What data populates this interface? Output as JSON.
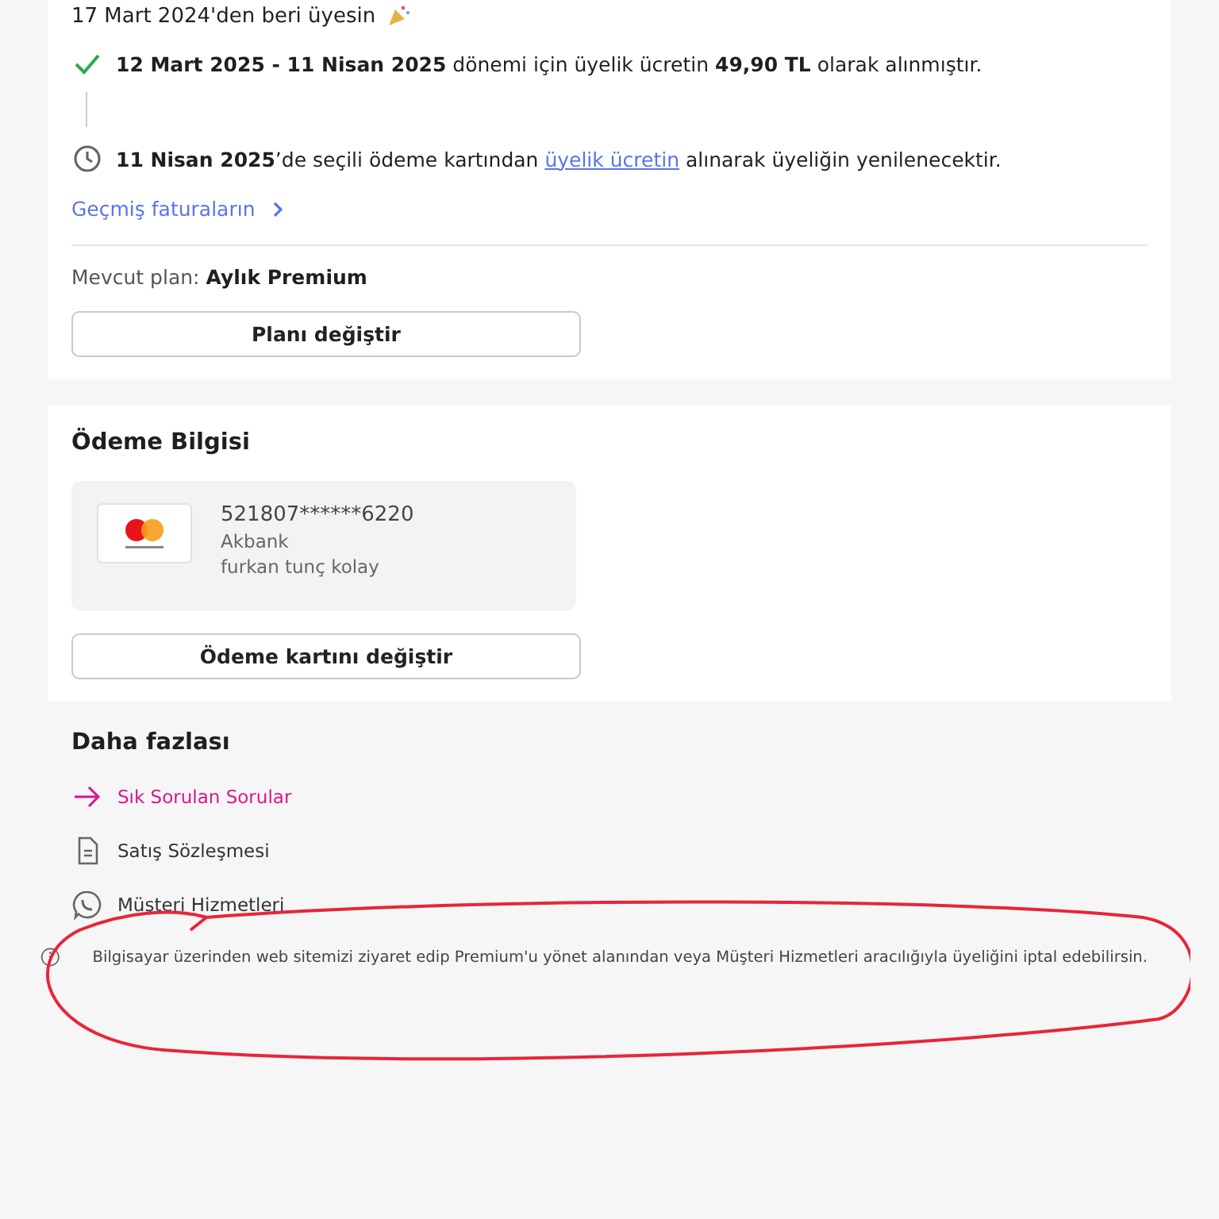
{
  "membership": {
    "since": "17 Mart 2024'den beri üyesin",
    "timeline": [
      {
        "kind": "done",
        "text": "**12 Mart 2025 - 11 Nisan 2025** dönemi için üyelik ücretin **49,90 TL** olarak alınmıştır."
      },
      {
        "kind": "pending",
        "text": "**11 Nisan 2025**’de seçili ödeme kartından ",
        "link": "üyelik ücretin",
        "text_after": " alınarak üyeliğin yenilenecektir."
      }
    ],
    "invoices_link": "Geçmiş faturaların",
    "plan_label": "Mevcut plan:",
    "plan_name": "Aylık Premium",
    "change_plan_button": "Planı değiştir"
  },
  "payment": {
    "title": "Ödeme Bilgisi",
    "card_number": "521807******6220",
    "bank": "Akbank",
    "holder": "furkan tunç kolay",
    "change_card_button": "Ödeme kartını değiştir"
  },
  "more": {
    "title": "Daha fazlası",
    "links": [
      {
        "kind": "arrow",
        "label": "Sık Sorulan Sorular",
        "color": "#d6168c"
      },
      {
        "kind": "document",
        "label": "Satış Sözleşmesi",
        "color": "#333333"
      },
      {
        "kind": "chat",
        "label": "Müşteri Hizmetleri",
        "color": "#333333"
      }
    ],
    "info": "Bilgisayar üzerinden web sitemizi ziyaret edip Premium'u yönet alanından veya Müşteri Hizmetleri aracılığıyla üyeliğini iptal edebilirsin."
  }
}
